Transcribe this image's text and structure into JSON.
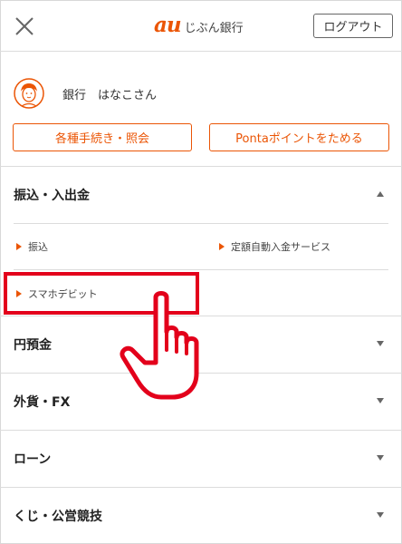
{
  "header": {
    "logo_mark": "au",
    "logo_text": "じぶん銀行",
    "logout_label": "ログアウト"
  },
  "user": {
    "name": "銀行　はなこさん"
  },
  "actions": {
    "procedures_label": "各種手続き・照会",
    "ponta_label": "Pontaポイントをためる"
  },
  "menu": {
    "transfer": {
      "label": "振込・入出金",
      "expanded": true,
      "items": [
        {
          "label": "振込"
        },
        {
          "label": "定額自動入金サービス"
        },
        {
          "label": "スマホデビット"
        }
      ]
    },
    "categories": [
      {
        "label": "円預金"
      },
      {
        "label": "外貨・FX"
      },
      {
        "label": "ローン"
      },
      {
        "label": "くじ・公営競技"
      }
    ]
  },
  "colors": {
    "accent": "#eb5505",
    "highlight": "#e3001b"
  },
  "icons": {
    "close": "close-icon",
    "avatar": "user-avatar-icon",
    "pointer": "pointing-hand-icon"
  }
}
